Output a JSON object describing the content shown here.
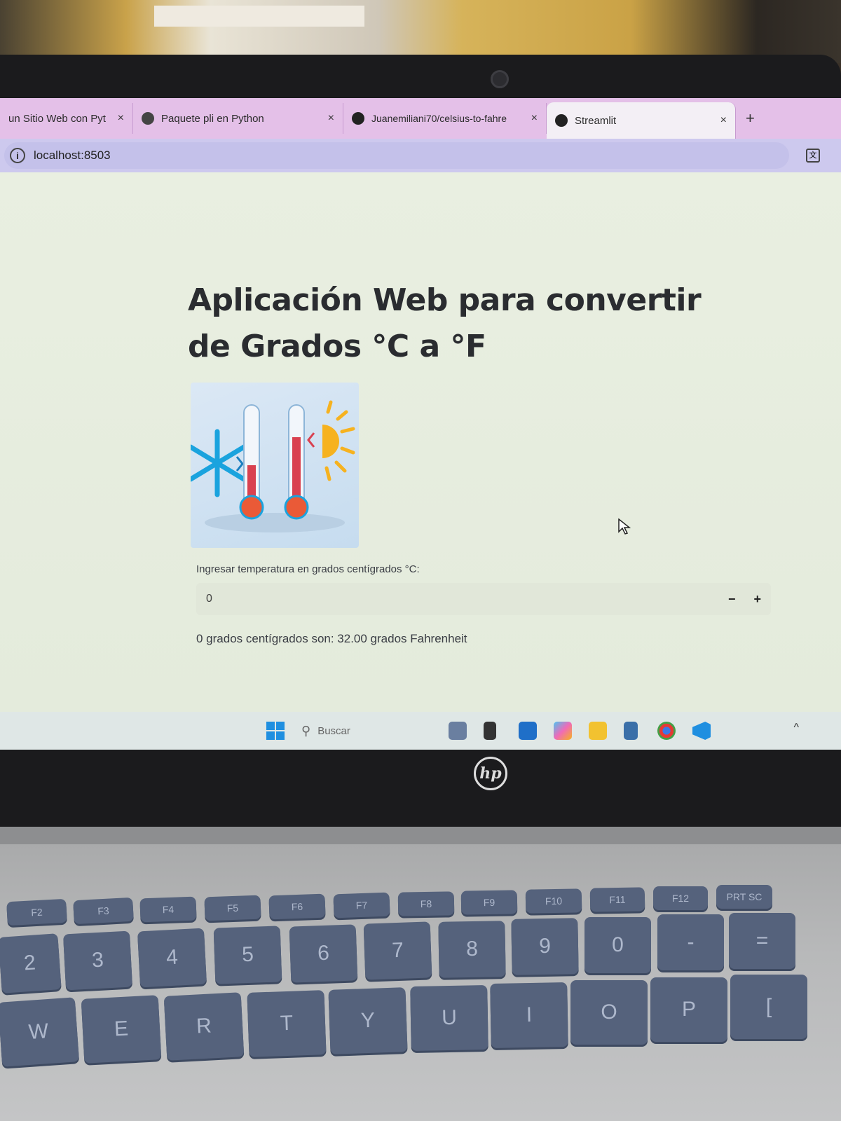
{
  "browser": {
    "tabs": [
      {
        "label": "un Sitio Web con Pyt",
        "active": false
      },
      {
        "label": "Paquete pli en Python",
        "active": false
      },
      {
        "label": "Juanemiliani70/celsius-to-fahre",
        "active": false
      },
      {
        "label": "Streamlit",
        "active": true
      }
    ],
    "close_glyph": "×",
    "newtab_glyph": "+",
    "url": "localhost:8503"
  },
  "page": {
    "title": "Aplicación Web para convertir de Grados °C a °F",
    "input_label": "Ingresar temperatura en grados centígrados °C:",
    "input_value": "0",
    "stepper_minus": "−",
    "stepper_plus": "+",
    "result_text": "0 grados centígrados son: 32.00 grados Fahrenheit"
  },
  "taskbar": {
    "search_placeholder": "Buscar"
  },
  "laptop": {
    "brand": "hp"
  },
  "keyboard": {
    "fn_row": [
      "F2",
      "F3",
      "F4",
      "F5",
      "F6",
      "F7",
      "F8",
      "F9",
      "F10",
      "F11",
      "F12",
      "PRT SC"
    ],
    "number_row": [
      "2",
      "3",
      "4",
      "5",
      "6",
      "7",
      "8",
      "9",
      "0",
      "-",
      "="
    ],
    "letter_row": [
      "W",
      "E",
      "R",
      "T",
      "Y",
      "U",
      "I",
      "O",
      "P",
      "["
    ]
  },
  "colors": {
    "tabstrip": "#e4c0e8",
    "addressbar": "#cdc9ee",
    "page_bg": "#e6ecdd",
    "key": "#55627c"
  }
}
